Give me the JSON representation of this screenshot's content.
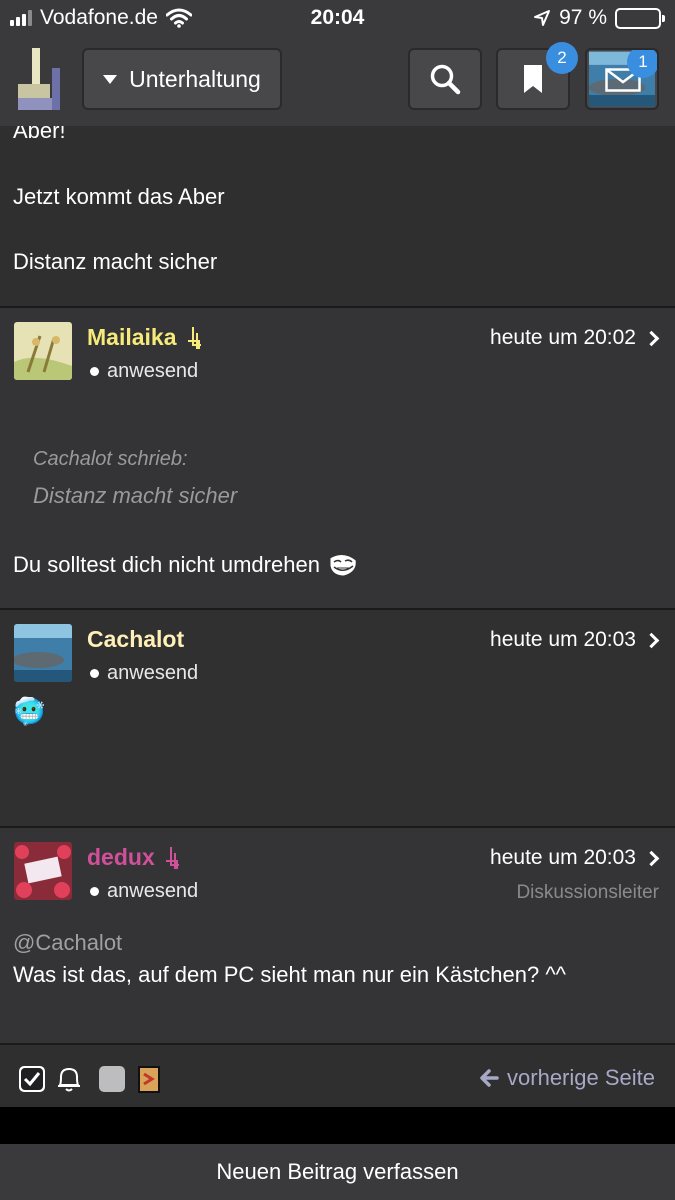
{
  "status_bar": {
    "carrier": "Vodafone.de",
    "time": "20:04",
    "battery": "97 %",
    "battery_level": 0.97
  },
  "toolbar": {
    "forum_label": "Unterhaltung",
    "bookmarks_count": "2",
    "messages_count": "1"
  },
  "top_post": {
    "lines": [
      "Aber!",
      "Jetzt kommt das Aber",
      "Distanz macht sicher"
    ]
  },
  "posts": [
    {
      "username": "Mailaika",
      "username_color": "#f5ea7a",
      "status": "anwesend",
      "time": "heute um 20:02",
      "quote_author": "Cachalot schrieb:",
      "quote_text": "Distanz macht sicher",
      "text": "Du solltest dich nicht umdrehen"
    },
    {
      "username": "Cachalot",
      "username_color": "#fff0b8",
      "status": "anwesend",
      "time": "heute um 20:03",
      "emoji": "🥶"
    },
    {
      "username": "dedux",
      "username_color": "#d0509a",
      "status": "anwesend",
      "time": "heute um 20:03",
      "role": "Diskussionsleiter",
      "mention": "@Cachalot",
      "text": "Was ist das, auf dem PC sieht man nur ein Kästchen? ^^"
    }
  ],
  "footer": {
    "prev_label": "vorherige Seite",
    "new_post_label": "Neuen Beitrag verfassen"
  },
  "icons": [
    "signal-icon",
    "wifi-icon",
    "location-icon",
    "battery-icon",
    "forum-logo-icon",
    "search-icon",
    "bookmark-icon",
    "envelope-icon",
    "chevron-right-icon",
    "checkbox-icon",
    "bell-icon",
    "square-icon",
    "document-icon",
    "arrow-left-icon"
  ]
}
